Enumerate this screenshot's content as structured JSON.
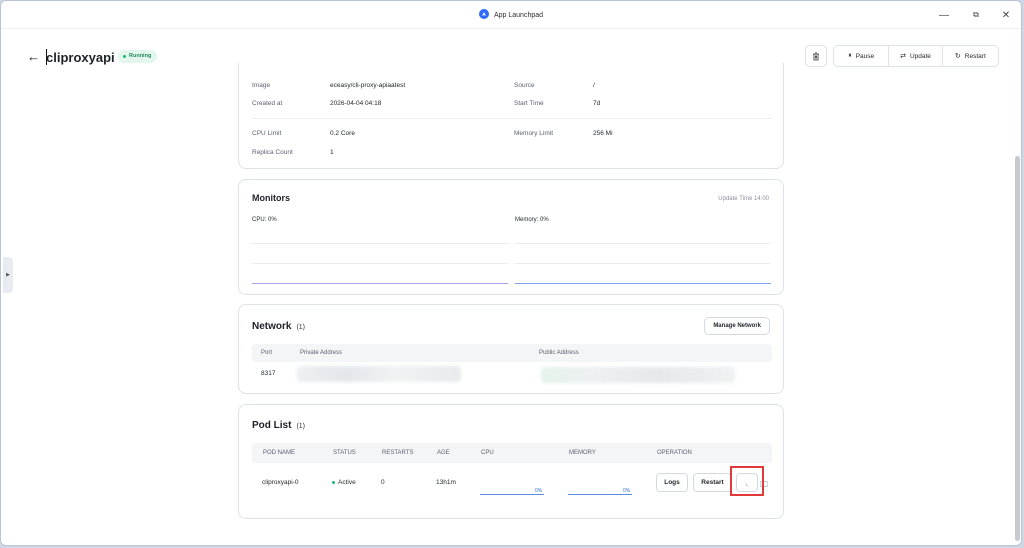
{
  "window": {
    "title": "App Launchpad",
    "min_icon": "minimize-icon",
    "max_icon": "maximize-icon",
    "close_icon": "close-icon"
  },
  "header": {
    "app_name": "cliproxyapi",
    "status": "Running",
    "buttons": {
      "pause": "Pause",
      "update": "Update",
      "restart": "Restart"
    }
  },
  "info": {
    "rows": [
      {
        "label": "Image",
        "value": "eceasy/cli-proxy-apiaatest"
      },
      {
        "label": "Created at",
        "value": "2026-04-04 04:18"
      },
      {
        "label": "CPU Limit",
        "value": "0.2 Core"
      },
      {
        "label": "Replica Count",
        "value": "1"
      },
      {
        "label": "Source",
        "value": "/"
      },
      {
        "label": "Start Time",
        "value": "7d"
      },
      {
        "label": "Memory Limit",
        "value": "256 Mi"
      }
    ]
  },
  "monitors": {
    "title": "Monitors",
    "update_time": "Update Time  14:00",
    "cpu_label": "CPU:  0%",
    "memory_label": "Memory:  0%",
    "colors": {
      "cpu_line": "#b19cf0",
      "memory_line": "#7ea6ef"
    }
  },
  "network": {
    "title": "Network",
    "count": "(1)",
    "manage_button": "Manage Network",
    "columns": [
      "Port",
      "Private Address",
      "Public Address"
    ],
    "rows": [
      {
        "port": "8317"
      }
    ]
  },
  "pods": {
    "title": "Pod List",
    "count": "(1)",
    "columns": [
      "POD NAME",
      "STATUS",
      "RESTARTS",
      "AGE",
      "CPU",
      "MEMORY",
      "OPERATION"
    ],
    "rows": [
      {
        "name": "cliproxyapi-0",
        "status": "Active",
        "restarts": "0",
        "age": "13h1m",
        "cpu_pct": "0%",
        "memory_pct": "0%",
        "ops": {
          "logs": "Logs",
          "restart": "Restart"
        }
      }
    ]
  }
}
